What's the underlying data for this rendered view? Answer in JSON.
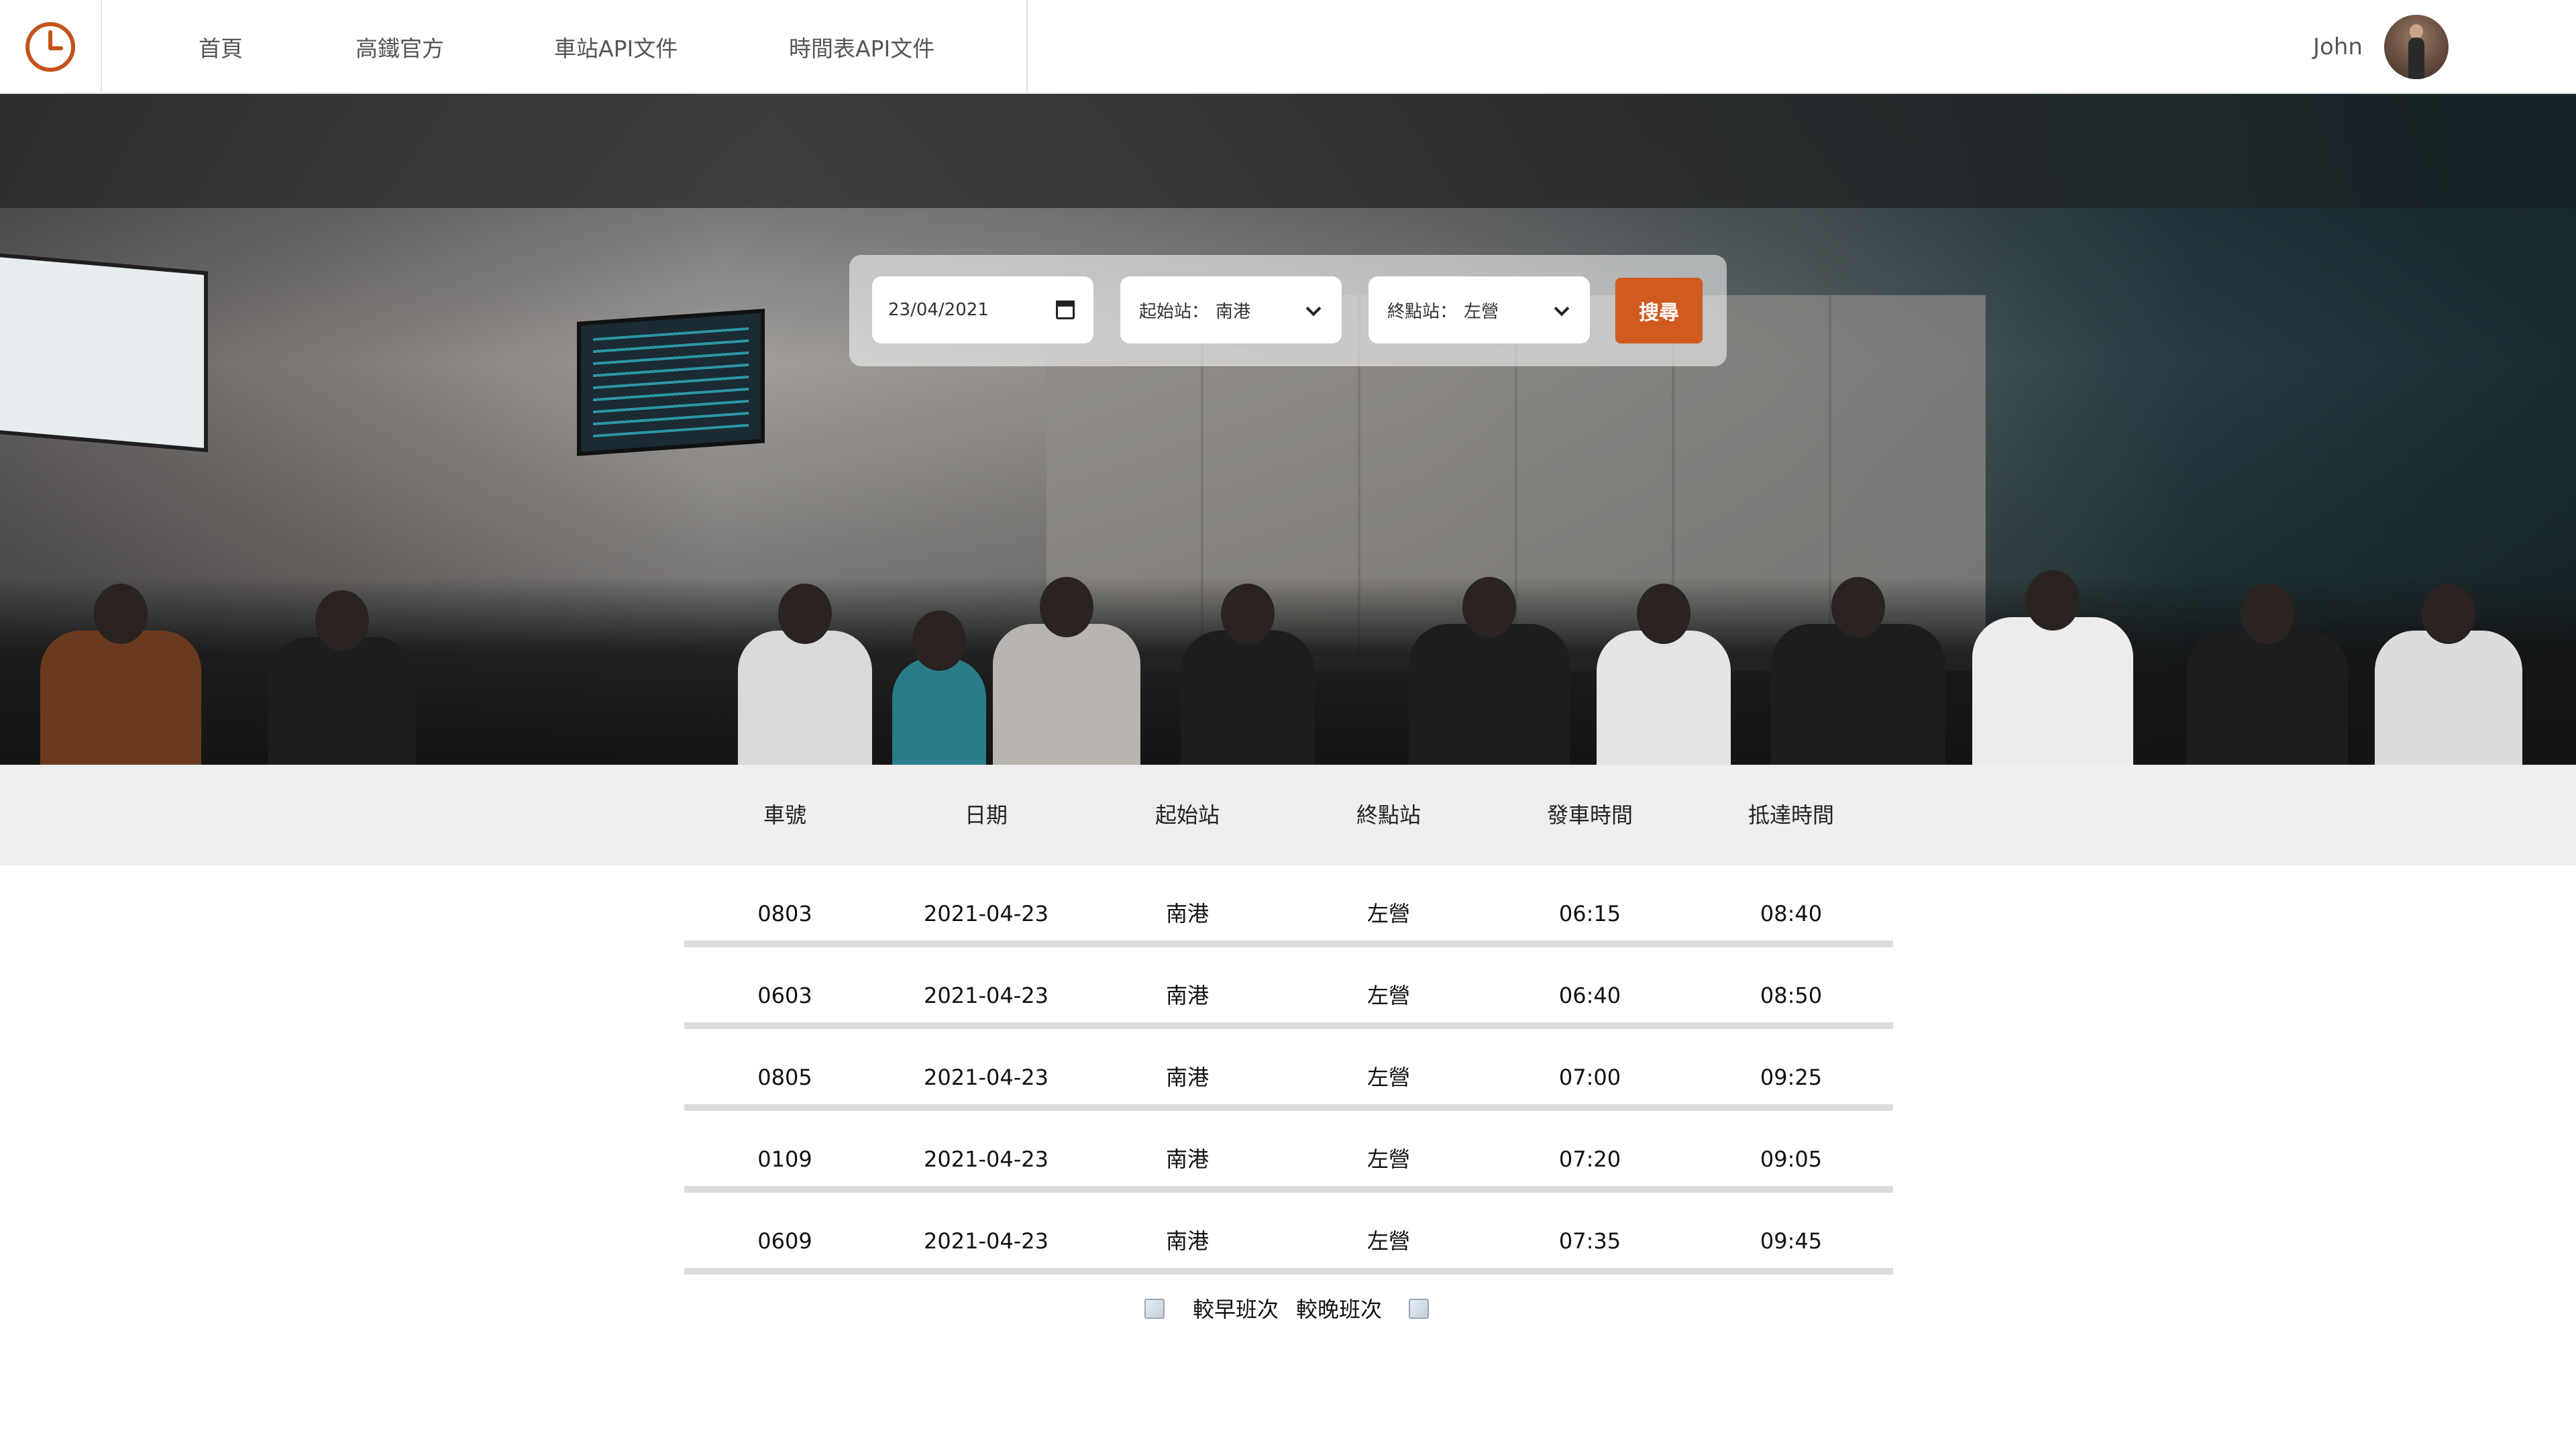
{
  "nav": {
    "logo_icon": "clock-icon",
    "items": [
      "首頁",
      "高鐵官方",
      "車站API文件",
      "時間表API文件"
    ]
  },
  "user": {
    "name": "John"
  },
  "search": {
    "date_value": "23/04/2021",
    "from_label": "起始站：",
    "from_value": "南港",
    "to_label": "終點站：",
    "to_value": "左營",
    "button_label": "搜尋"
  },
  "table": {
    "headers": [
      "車號",
      "日期",
      "起始站",
      "終點站",
      "發車時間",
      "抵達時間"
    ],
    "rows": [
      [
        "0803",
        "2021-04-23",
        "南港",
        "左營",
        "06:15",
        "08:40"
      ],
      [
        "0603",
        "2021-04-23",
        "南港",
        "左營",
        "06:40",
        "08:50"
      ],
      [
        "0805",
        "2021-04-23",
        "南港",
        "左營",
        "07:00",
        "09:25"
      ],
      [
        "0109",
        "2021-04-23",
        "南港",
        "左營",
        "07:20",
        "09:05"
      ],
      [
        "0609",
        "2021-04-23",
        "南港",
        "左營",
        "07:35",
        "09:45"
      ]
    ]
  },
  "pager": {
    "earlier_label": "較早班次",
    "later_label": "較晚班次"
  },
  "colors": {
    "accent": "#d15a1e",
    "header_bg": "#eeeeee",
    "row_divider": "#dcdcdc"
  }
}
